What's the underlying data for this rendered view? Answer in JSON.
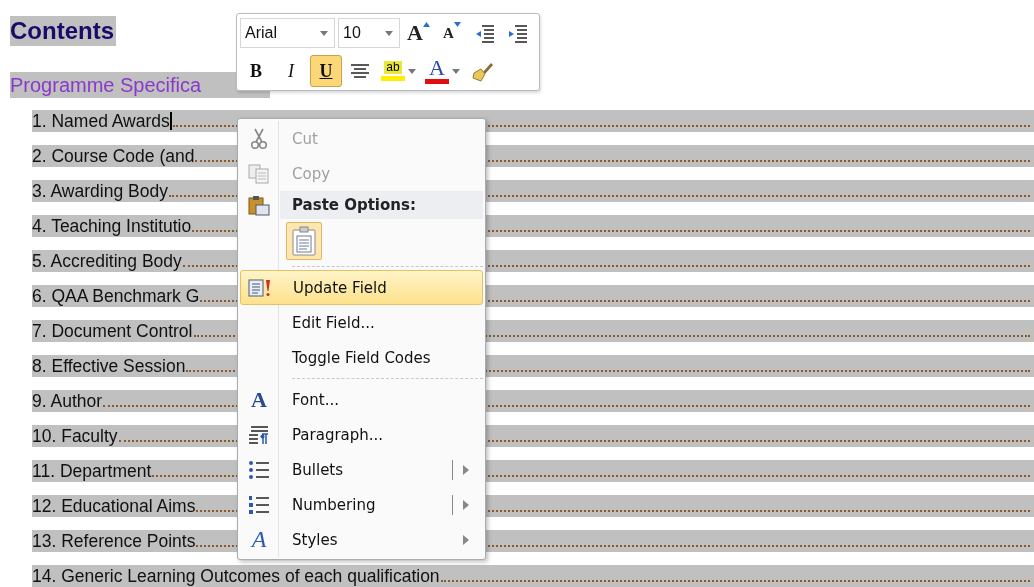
{
  "document": {
    "heading": "Contents",
    "subheading": "Programme Specifica",
    "rows": [
      {
        "text": "1. Named Awards",
        "cursor": true
      },
      {
        "text": "2. Course Code (and",
        "cursor": false
      },
      {
        "text": "3. Awarding Body",
        "cursor": false
      },
      {
        "text": "4. Teaching Institutio",
        "cursor": false
      },
      {
        "text": "5. Accrediting Body",
        "cursor": false
      },
      {
        "text": "6. QAA Benchmark G",
        "cursor": false
      },
      {
        "text": "7. Document Control",
        "cursor": false
      },
      {
        "text": "8. Effective Session",
        "cursor": false
      },
      {
        "text": "9. Author",
        "cursor": false
      },
      {
        "text": "10. Faculty",
        "cursor": false
      },
      {
        "text": "11. Department",
        "cursor": false
      },
      {
        "text": "12. Educational Aims",
        "cursor": false
      },
      {
        "text": "13. Reference Points",
        "cursor": false
      },
      {
        "text": "14. Generic Learning Outcomes of each qualification",
        "cursor": false
      }
    ]
  },
  "mini_toolbar": {
    "font": "Arial",
    "size": "10",
    "row_1": [
      {
        "kind": "grow",
        "label": "A"
      },
      {
        "kind": "shrink",
        "label": "A"
      },
      {
        "kind": "outdent"
      },
      {
        "kind": "indent"
      }
    ],
    "row_2": [
      {
        "kind": "bold",
        "label": "B",
        "on": false
      },
      {
        "kind": "italic",
        "label": "I",
        "on": false
      },
      {
        "kind": "underline",
        "label": "U",
        "on": true
      },
      {
        "kind": "center"
      },
      {
        "kind": "highlight",
        "label": "ab"
      },
      {
        "kind": "fontcolor",
        "label": "A"
      },
      {
        "kind": "painter"
      }
    ]
  },
  "context_menu": [
    {
      "kind": "item",
      "label": "Cut",
      "disabled": true,
      "selected": false,
      "submenu": false,
      "split": false
    },
    {
      "kind": "item",
      "label": "Copy",
      "disabled": true,
      "selected": false,
      "submenu": false,
      "split": false
    },
    {
      "kind": "header",
      "label": "Paste Options:"
    },
    {
      "kind": "paste"
    },
    {
      "kind": "separator"
    },
    {
      "kind": "item",
      "label": "Update Field",
      "disabled": false,
      "selected": true,
      "submenu": false,
      "split": false
    },
    {
      "kind": "item",
      "label": "Edit Field...",
      "disabled": false,
      "selected": false,
      "submenu": false,
      "split": false
    },
    {
      "kind": "item",
      "label": "Toggle Field Codes",
      "disabled": false,
      "selected": false,
      "submenu": false,
      "split": false
    },
    {
      "kind": "separator"
    },
    {
      "kind": "item",
      "icon_text": "A",
      "label": "Font...",
      "disabled": false,
      "selected": false,
      "submenu": false,
      "split": false
    },
    {
      "kind": "item",
      "label": "Paragraph...",
      "disabled": false,
      "selected": false,
      "submenu": false,
      "split": false
    },
    {
      "kind": "item",
      "label": "Bullets",
      "disabled": false,
      "selected": false,
      "submenu": true,
      "split": true
    },
    {
      "kind": "item",
      "label": "Numbering",
      "disabled": false,
      "selected": false,
      "submenu": true,
      "split": true
    },
    {
      "kind": "item",
      "icon_text": "A",
      "label": "Styles",
      "disabled": false,
      "selected": false,
      "submenu": true,
      "split": false
    }
  ]
}
